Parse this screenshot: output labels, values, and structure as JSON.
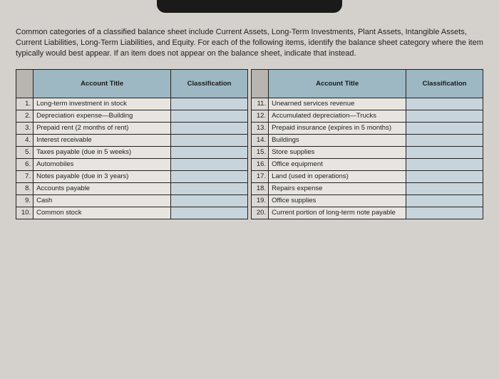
{
  "instructions": "Common categories of a classified balance sheet include Current Assets, Long-Term Investments, Plant Assets, Intangible Assets, Current Liabilities, Long-Term Liabilities, and Equity. For each of the following items, identify the balance sheet category where the item typically would best appear. If an item does not appear on the balance sheet, indicate that instead.",
  "headers": {
    "account_title": "Account Title",
    "classification": "Classification"
  },
  "left_rows": [
    {
      "num": "1.",
      "title": "Long-term investment in stock",
      "class": ""
    },
    {
      "num": "2.",
      "title": "Depreciation expense—Building",
      "class": ""
    },
    {
      "num": "3.",
      "title": "Prepaid rent (2 months of rent)",
      "class": ""
    },
    {
      "num": "4.",
      "title": "Interest receivable",
      "class": ""
    },
    {
      "num": "5.",
      "title": "Taxes payable (due in 5 weeks)",
      "class": ""
    },
    {
      "num": "6.",
      "title": "Automobiles",
      "class": ""
    },
    {
      "num": "7.",
      "title": "Notes payable (due in 3 years)",
      "class": ""
    },
    {
      "num": "8.",
      "title": "Accounts payable",
      "class": ""
    },
    {
      "num": "9.",
      "title": "Cash",
      "class": ""
    },
    {
      "num": "10.",
      "title": "Common stock",
      "class": ""
    }
  ],
  "right_rows": [
    {
      "num": "11.",
      "title": "Unearned services revenue",
      "class": ""
    },
    {
      "num": "12.",
      "title": "Accumulated depreciation—Trucks",
      "class": ""
    },
    {
      "num": "13.",
      "title": "Prepaid insurance (expires in 5 months)",
      "class": ""
    },
    {
      "num": "14.",
      "title": "Buildings",
      "class": ""
    },
    {
      "num": "15.",
      "title": "Store supplies",
      "class": ""
    },
    {
      "num": "16.",
      "title": "Office equipment",
      "class": ""
    },
    {
      "num": "17.",
      "title": "Land (used in operations)",
      "class": ""
    },
    {
      "num": "18.",
      "title": "Repairs expense",
      "class": ""
    },
    {
      "num": "19.",
      "title": "Office supplies",
      "class": ""
    },
    {
      "num": "20.",
      "title": "Current portion of long-term note payable",
      "class": ""
    }
  ]
}
